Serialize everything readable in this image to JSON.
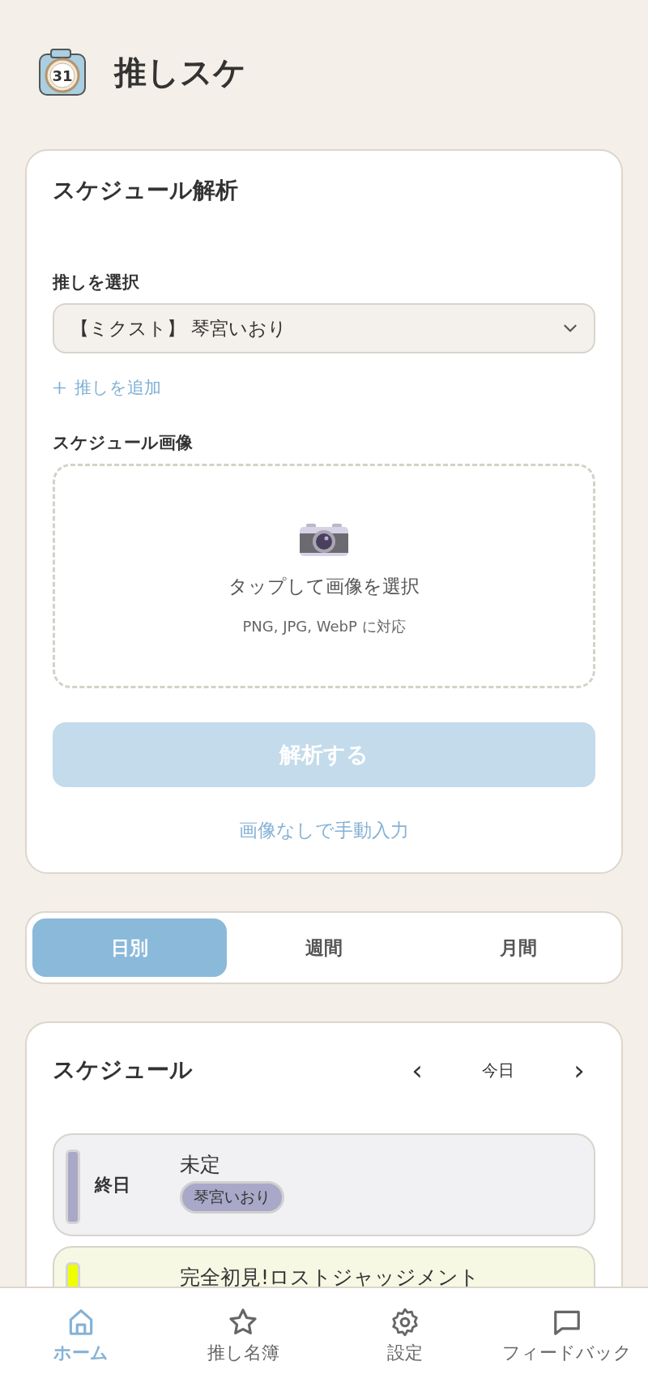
{
  "app": {
    "title": "推しスケ",
    "logo_text": "31"
  },
  "analysis": {
    "title": "スケジュール解析",
    "oshi_label": "推しを選択",
    "oshi_value": "【ミクスト】 琴宮いおり",
    "add_oshi": "推しを追加",
    "image_label": "スケジュール画像",
    "drop_text": "タップして画像を選択",
    "drop_hint": "PNG, JPG, WebP に対応",
    "analyze_button": {
      "label": "解析する",
      "disabled": true
    },
    "manual_link": "画像なしで手動入力"
  },
  "view_tabs": [
    {
      "label": "日別",
      "selected": true
    },
    {
      "label": "週間",
      "selected": false
    },
    {
      "label": "月間",
      "selected": false
    }
  ],
  "schedule": {
    "title": "スケジュール",
    "prev": "‹",
    "period": "今日",
    "next": "›",
    "events": [
      {
        "time": "終日",
        "title": "未定",
        "oshi": "琴宮いおり",
        "color": "#a9a8c8"
      },
      {
        "title": "完全初見!ロストジャッジメント",
        "color": "#eeff00"
      }
    ]
  },
  "nav": [
    {
      "label": "ホーム",
      "selected": true
    },
    {
      "label": "推し名簿",
      "selected": false
    },
    {
      "label": "設定",
      "selected": false
    },
    {
      "label": "フィードバック",
      "selected": false
    }
  ]
}
